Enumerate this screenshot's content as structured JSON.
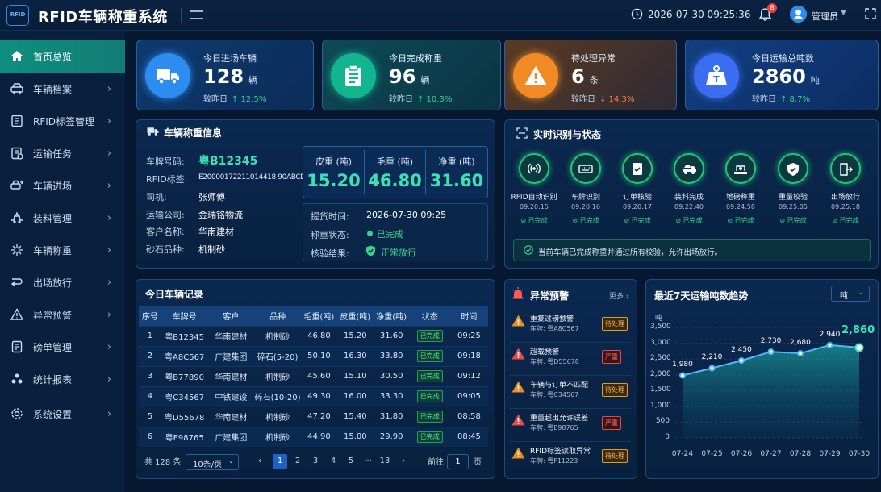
{
  "header": {
    "logo": "RFID",
    "title": "RFID车辆称重系统",
    "datetime": "2026-07-30  09:25:36",
    "notif_count": "8",
    "user": "管理员"
  },
  "sidebar": {
    "items": [
      {
        "label": "首页总览",
        "icon": "home-icon",
        "active": true
      },
      {
        "label": "车辆档案",
        "icon": "car-icon"
      },
      {
        "label": "RFID标签管理",
        "icon": "tag-icon"
      },
      {
        "label": "运输任务",
        "icon": "task-icon"
      },
      {
        "label": "车辆进场",
        "icon": "car-enter-icon"
      },
      {
        "label": "装料管理",
        "icon": "loading-icon"
      },
      {
        "label": "车辆称重",
        "icon": "scale-icon"
      },
      {
        "label": "出场放行",
        "icon": "exit-icon"
      },
      {
        "label": "异常预警",
        "icon": "warning-icon"
      },
      {
        "label": "磅单管理",
        "icon": "document-icon"
      },
      {
        "label": "统计报表",
        "icon": "report-icon"
      },
      {
        "label": "系统设置",
        "icon": "settings-icon"
      }
    ]
  },
  "kpis": [
    {
      "label": "今日进场车辆",
      "value": "128",
      "unit": "辆",
      "compare": "较昨日",
      "delta": "↑ 12.5%",
      "dir": "up",
      "color": "#2d8cf0"
    },
    {
      "label": "今日完成称重",
      "value": "96",
      "unit": "辆",
      "compare": "较昨日",
      "delta": "↑ 10.3%",
      "dir": "up",
      "color": "#12b58e"
    },
    {
      "label": "待处理异常",
      "value": "6",
      "unit": "条",
      "compare": "较昨日",
      "delta": "↓ 14.3%",
      "dir": "down",
      "color": "#f08a24"
    },
    {
      "label": "今日运输总吨数",
      "value": "2860",
      "unit": "吨",
      "compare": "较昨日",
      "delta": "↑ 8.7%",
      "dir": "up",
      "color": "#3a6df0"
    }
  ],
  "weigh": {
    "title": "车辆称重信息",
    "plate_label": "车牌号码:",
    "plate": "粤B12345",
    "rfid_label": "RFID标签:",
    "rfid": "E20000172211014418 90ABCD",
    "driver_label": "司机:",
    "driver": "张师傅",
    "company_label": "运输公司:",
    "company": "金瑞铭物流",
    "customer_label": "客户名称:",
    "customer": "华南建材",
    "stone_label": "砂石品种:",
    "stone": "机制砂",
    "tare_label": "皮重 (吨)",
    "tare": "15.20",
    "gross_label": "毛重 (吨)",
    "gross": "46.80",
    "net_label": "净重 (吨)",
    "net": "31.60",
    "pickup_label": "提货时间:",
    "pickup": "2026-07-30  09:25",
    "status_label": "称重状态:",
    "status": "已完成",
    "check_label": "核验结果:",
    "check": "正常放行"
  },
  "realtime": {
    "title": "实时识别与状态",
    "steps": [
      {
        "name": "RFID自动识别",
        "time": "09:20:15",
        "state": "已完成"
      },
      {
        "name": "车牌识别",
        "time": "09:20:16",
        "state": "已完成"
      },
      {
        "name": "订单核验",
        "time": "09:20:17",
        "state": "已完成"
      },
      {
        "name": "装料完成",
        "time": "09:22:40",
        "state": "已完成"
      },
      {
        "name": "地磅称重",
        "time": "09:24:58",
        "state": "已完成"
      },
      {
        "name": "重量校验",
        "time": "09:25:05",
        "state": "已完成"
      },
      {
        "name": "出场放行",
        "time": "09:25:18",
        "state": "已完成"
      }
    ],
    "notice": "当前车辆已完成称重并通过所有校验，允许出场放行。"
  },
  "records": {
    "title": "今日车辆记录",
    "headers": [
      "序号",
      "车牌号",
      "客户",
      "品种",
      "毛重(吨)",
      "皮重(吨)",
      "净重(吨)",
      "状态",
      "时间"
    ],
    "rows": [
      [
        "1",
        "粤B12345",
        "华南建材",
        "机制砂",
        "46.80",
        "15.20",
        "31.60",
        "已完成",
        "09:25"
      ],
      [
        "2",
        "粤A8C567",
        "广建集团",
        "碎石(5-20)",
        "50.10",
        "16.30",
        "33.80",
        "已完成",
        "09:18"
      ],
      [
        "3",
        "粤B77890",
        "华南建材",
        "机制砂",
        "45.60",
        "15.10",
        "30.50",
        "已完成",
        "09:12"
      ],
      [
        "4",
        "粤C34567",
        "中铁建设",
        "碎石(10-20)",
        "49.30",
        "16.00",
        "33.30",
        "已完成",
        "09:05"
      ],
      [
        "5",
        "粤D55678",
        "华南建材",
        "机制砂",
        "47.20",
        "15.40",
        "31.80",
        "已完成",
        "08:58"
      ],
      [
        "6",
        "粤E98765",
        "广建集团",
        "机制砂",
        "44.90",
        "15.00",
        "29.90",
        "已完成",
        "08:45"
      ]
    ],
    "total": "共 128 条",
    "page_size": "10条/页",
    "pages": [
      "1",
      "2",
      "3",
      "4",
      "5",
      "···",
      "13"
    ],
    "goto_label": "前往",
    "goto_value": "1",
    "page_suffix": "页"
  },
  "alerts": {
    "title": "异常预警",
    "more": "更多 ›",
    "items": [
      {
        "title": "重复过磅预警",
        "plate": "车牌: 粤A8C567",
        "tag": "待处理",
        "level": "pend"
      },
      {
        "title": "超载预警",
        "plate": "车牌: 粤D55678",
        "tag": "严重",
        "level": "sev"
      },
      {
        "title": "车辆与订单不匹配",
        "plate": "车牌: 粤C34567",
        "tag": "待处理",
        "level": "pend"
      },
      {
        "title": "重量超出允许误差",
        "plate": "车牌: 粤E98765",
        "tag": "严重",
        "level": "sev"
      },
      {
        "title": "RFID标签读取异常",
        "plate": "车牌: 粤F11223",
        "tag": "待处理",
        "level": "pend"
      }
    ]
  },
  "chart_data": {
    "type": "area",
    "title": "最近7天运输吨数趋势",
    "unit_select": "吨",
    "ylabel": "吨",
    "x": [
      "07-24",
      "07-25",
      "07-26",
      "07-27",
      "07-28",
      "07-29",
      "07-30"
    ],
    "values": [
      1980,
      2210,
      2450,
      2730,
      2680,
      2940,
      2860
    ],
    "value_labels": [
      "1,980",
      "2,210",
      "2,450",
      "2,730",
      "2,680",
      "2,940",
      "2,860"
    ],
    "ylim": [
      0,
      3500
    ],
    "yticks": [
      "3,500",
      "3,000",
      "2,500",
      "2,000",
      "1,500",
      "1,000",
      "500",
      "0"
    ],
    "yvals": [
      3500,
      3000,
      2500,
      2000,
      1500,
      1000,
      500,
      0
    ],
    "grid": true
  }
}
